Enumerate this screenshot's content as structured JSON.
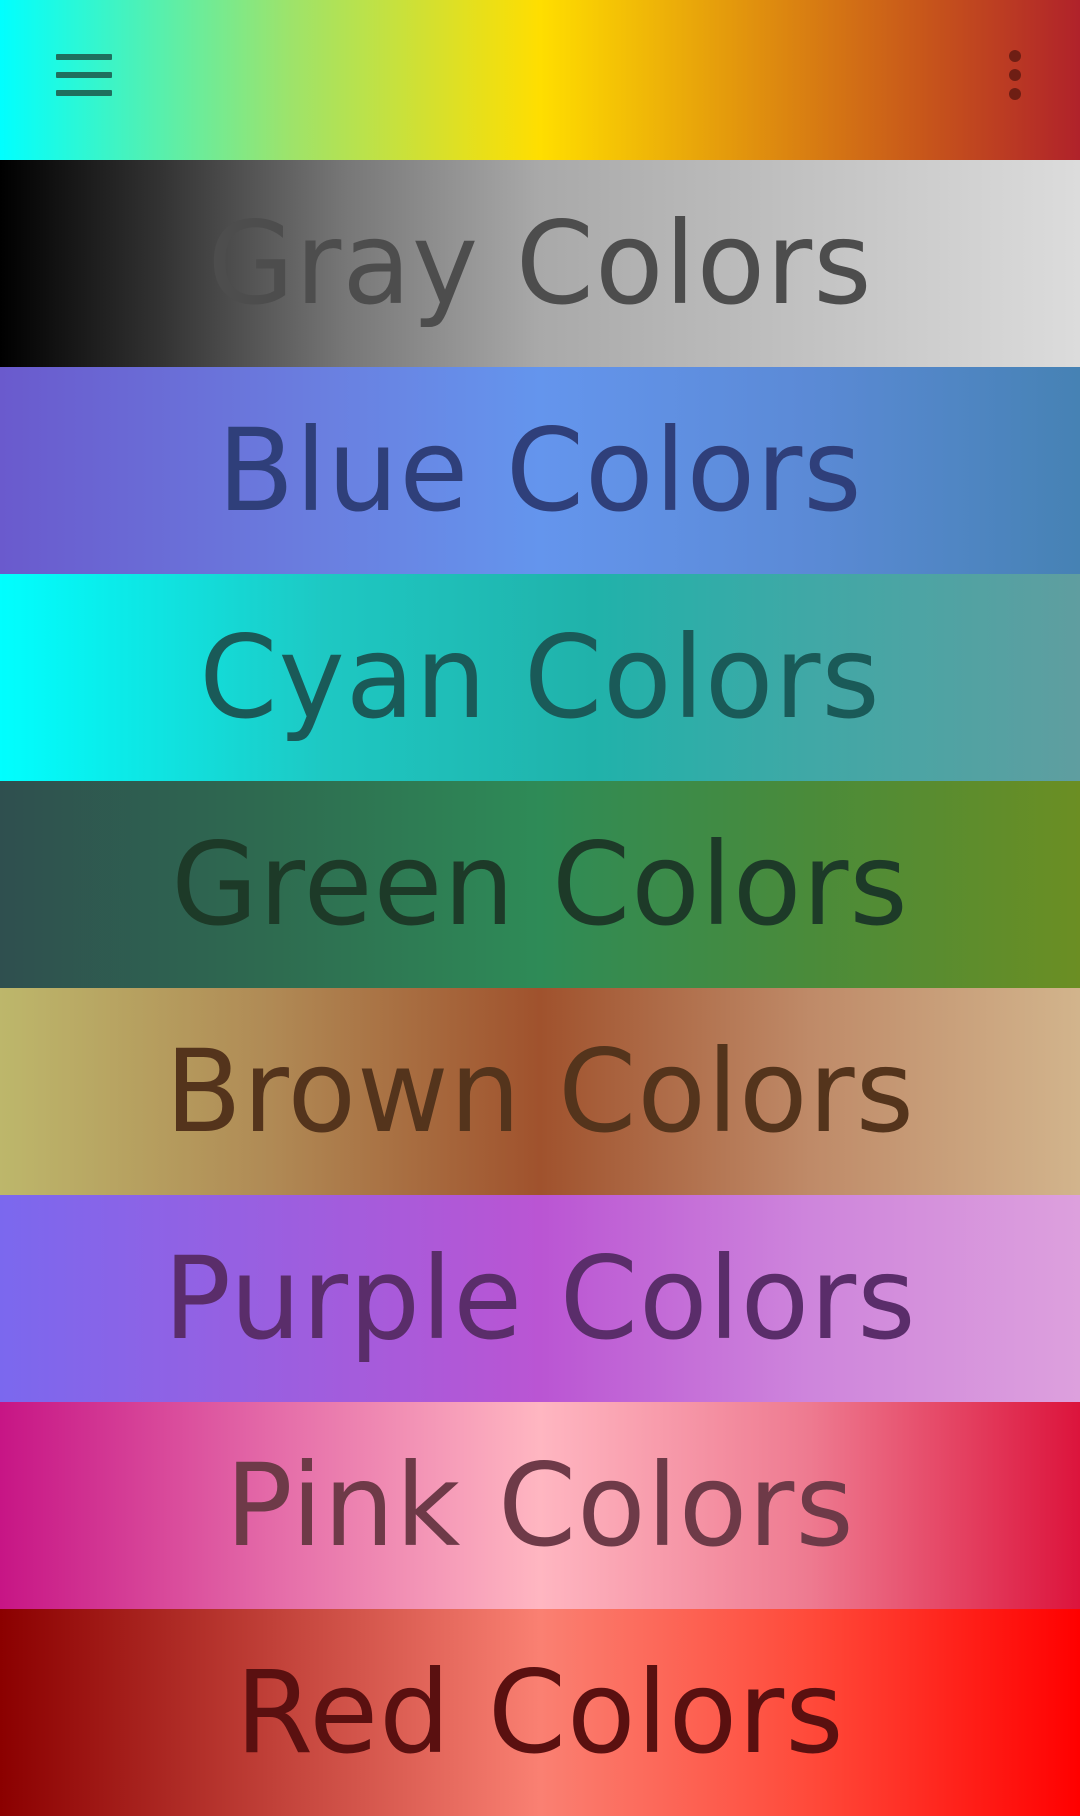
{
  "appbar": {
    "menu_icon": "hamburger-menu-icon",
    "overflow_icon": "vertical-dots-icon"
  },
  "categories": [
    {
      "label": "Gray Colors"
    },
    {
      "label": "Blue Colors"
    },
    {
      "label": "Cyan Colors"
    },
    {
      "label": "Green Colors"
    },
    {
      "label": "Brown Colors"
    },
    {
      "label": "Purple Colors"
    },
    {
      "label": "Pink Colors"
    },
    {
      "label": "Red Colors"
    }
  ],
  "colors": {
    "appbar_gradient": [
      "#00ffff",
      "#ffde00",
      "#b0222a"
    ],
    "gray_gradient": [
      "#000000",
      "#a9a9a9",
      "#dcdcdc"
    ],
    "blue_gradient": [
      "#6a5acd",
      "#6495ed",
      "#4682b4"
    ],
    "cyan_gradient": [
      "#00ffff",
      "#20b2aa",
      "#5f9ea0"
    ],
    "green_gradient": [
      "#2f4f4f",
      "#2e8b57",
      "#6b8e23"
    ],
    "brown_gradient": [
      "#bdb76b",
      "#a0522d",
      "#d2b48c"
    ],
    "purple_gradient": [
      "#7b68ee",
      "#ba55d3",
      "#dda0dd"
    ],
    "pink_gradient": [
      "#c71585",
      "#ffb6c1",
      "#dc143c"
    ],
    "red_gradient": [
      "#8b0000",
      "#fa8072",
      "#ff0000"
    ]
  }
}
